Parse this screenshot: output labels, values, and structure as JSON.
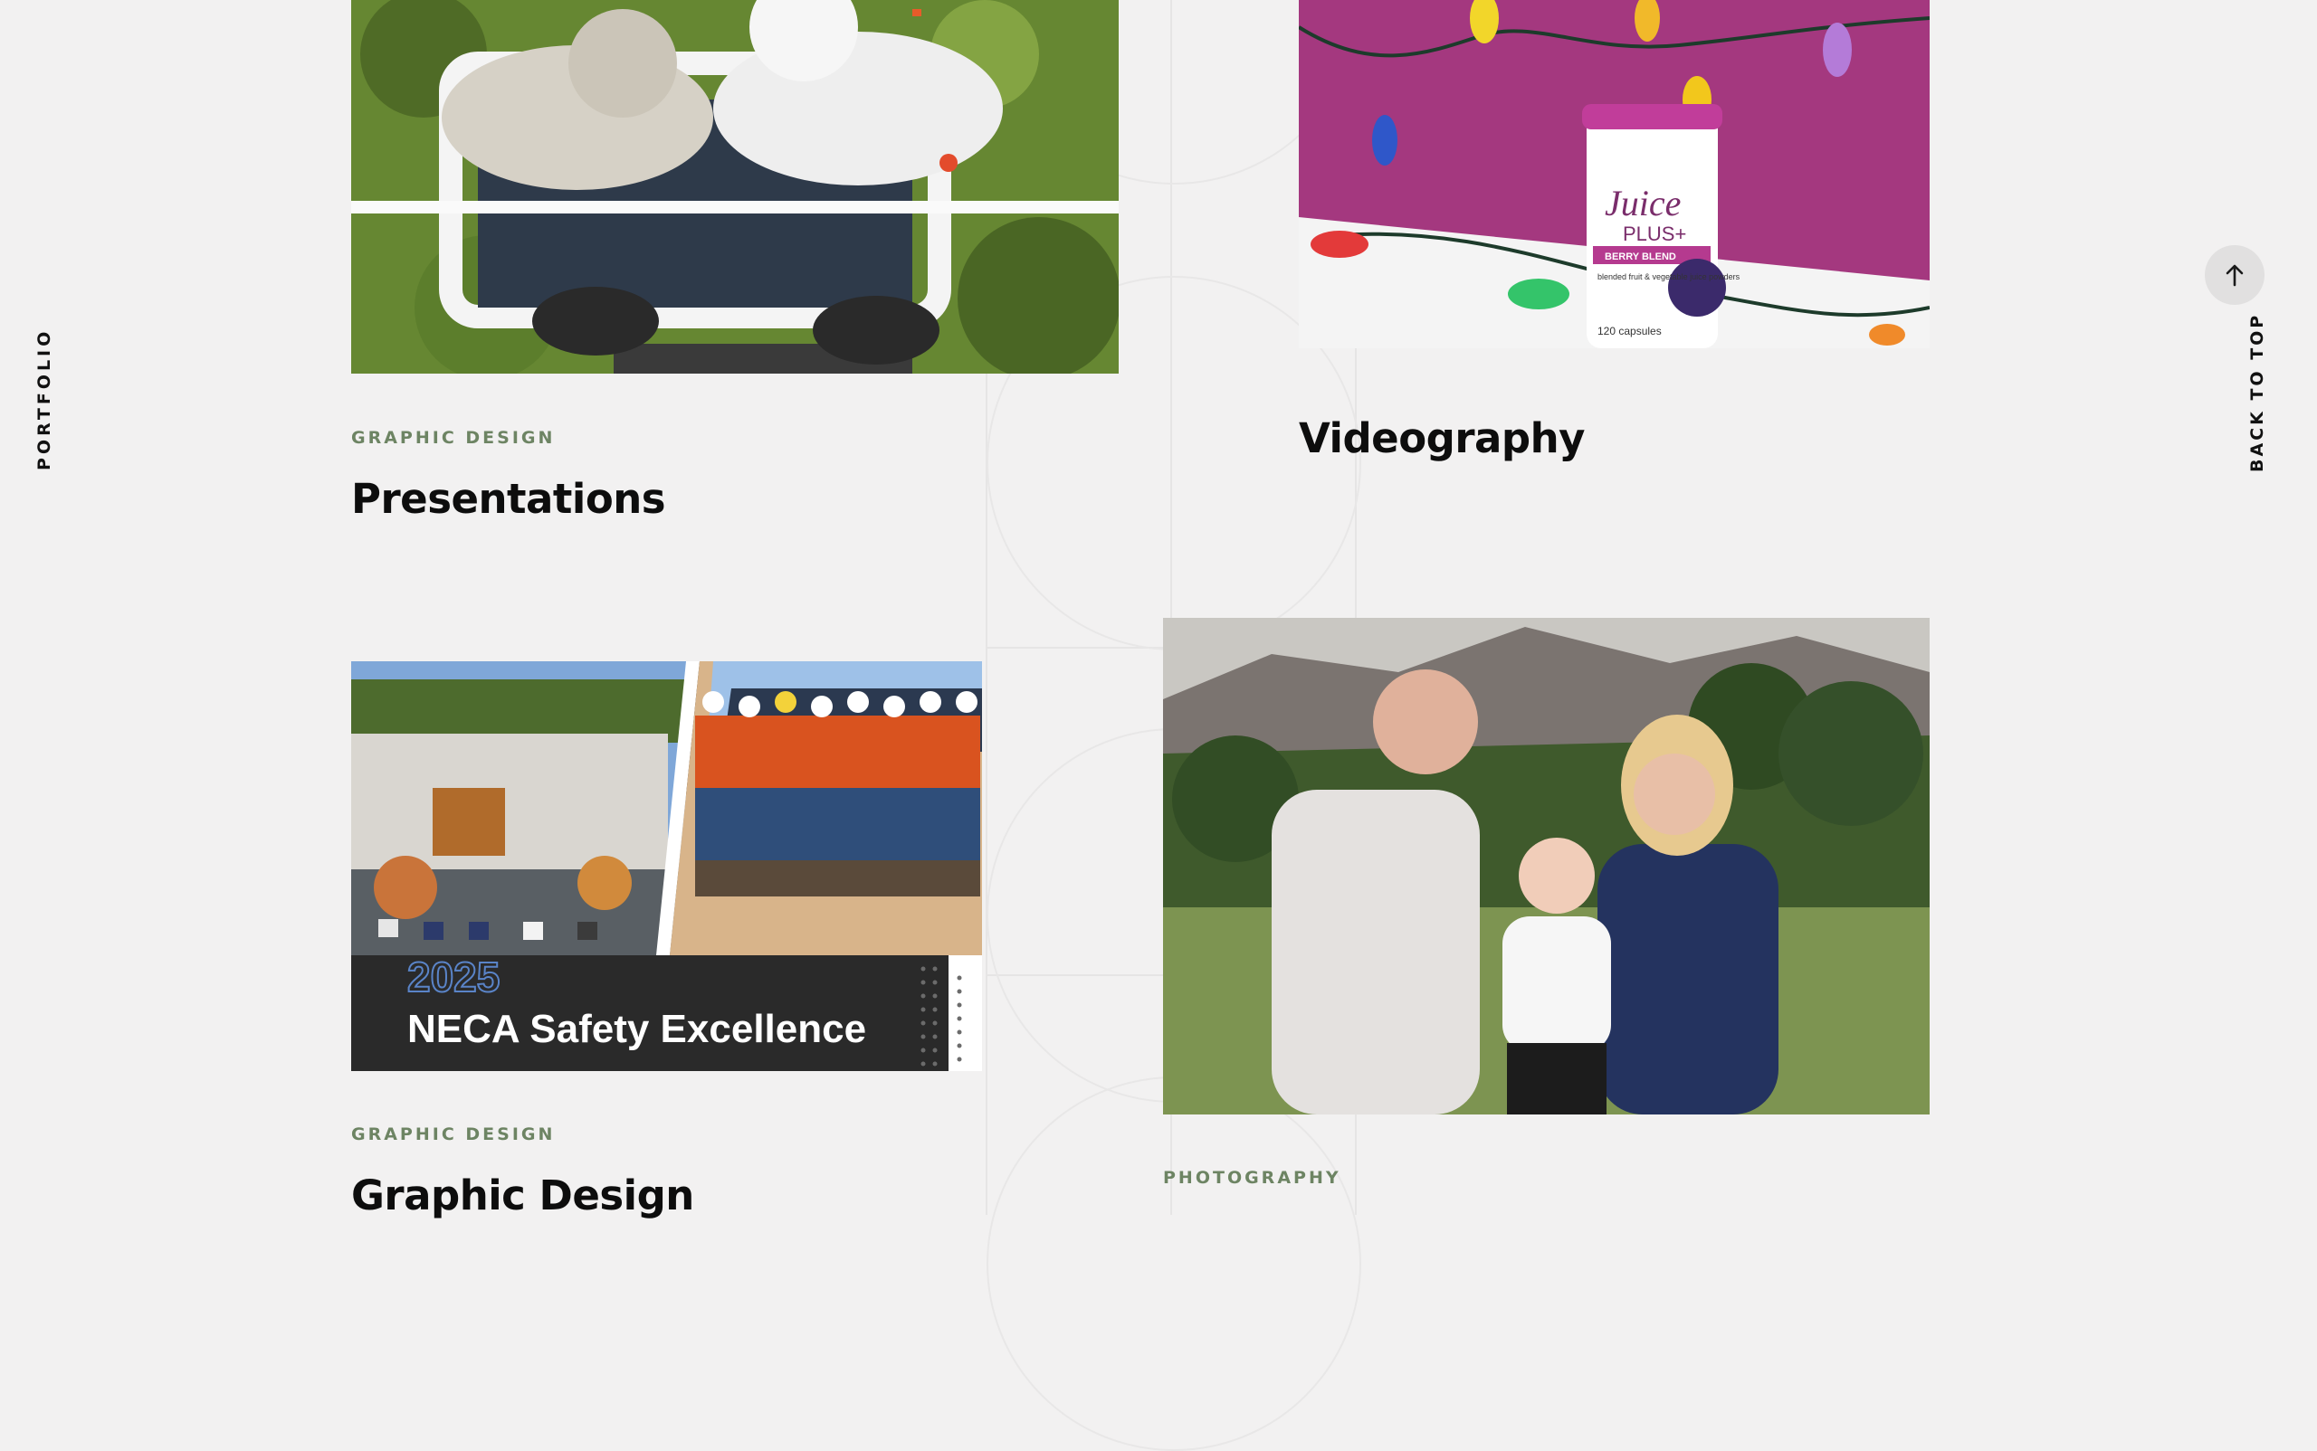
{
  "sidebar": {
    "label": "PORTFOLIO"
  },
  "back_to_top": {
    "label": "BACK TO TOP",
    "icon": "arrow-up-icon"
  },
  "cards": [
    {
      "category": "GRAPHIC DESIGN",
      "title": "Presentations",
      "image": "Aerial photo of two workers in white protective suits on an equipment platform"
    },
    {
      "category": "",
      "title": "Videography",
      "image": "Juice Plus product jar with colorful string lights on a magenta background"
    },
    {
      "category": "GRAPHIC DESIGN",
      "title": "Graphic Design",
      "image": "Safety award graphic with building and crew of workers",
      "overlay": {
        "year": "2025",
        "headline": "NECA Safety Excellence"
      }
    },
    {
      "category": "PHOTOGRAPHY",
      "title": "",
      "image": "Family portrait outdoors with mountains in background"
    }
  ],
  "product": {
    "brand_line1": "Juice",
    "brand_line2": "PLUS+",
    "variant": "BERRY BLEND",
    "desc": "blended fruit & vegetable juice powders",
    "count": "120 capsules"
  },
  "colors": {
    "background": "#f2f1f1",
    "accent_green": "#6d8463",
    "magenta": "#a4387f"
  }
}
